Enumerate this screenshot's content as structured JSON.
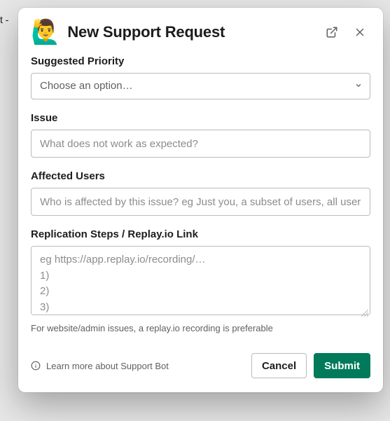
{
  "background_text": "t - ",
  "modal": {
    "emoji": "🙋‍♂️",
    "title": "New Support Request",
    "fields": {
      "priority": {
        "label": "Suggested Priority",
        "placeholder": "Choose an option…"
      },
      "issue": {
        "label": "Issue",
        "placeholder": "What does not work as expected?"
      },
      "affected_users": {
        "label": "Affected Users",
        "placeholder": "Who is affected by this issue? eg Just you, a subset of users, all user"
      },
      "replication": {
        "label": "Replication Steps / Replay.io Link",
        "placeholder": "eg https://app.replay.io/recording/…\n1)\n2)\n3)",
        "helper": "For website/admin issues, a replay.io recording is preferable"
      }
    },
    "footer": {
      "learn_more": "Learn more about Support Bot",
      "cancel": "Cancel",
      "submit": "Submit"
    }
  }
}
